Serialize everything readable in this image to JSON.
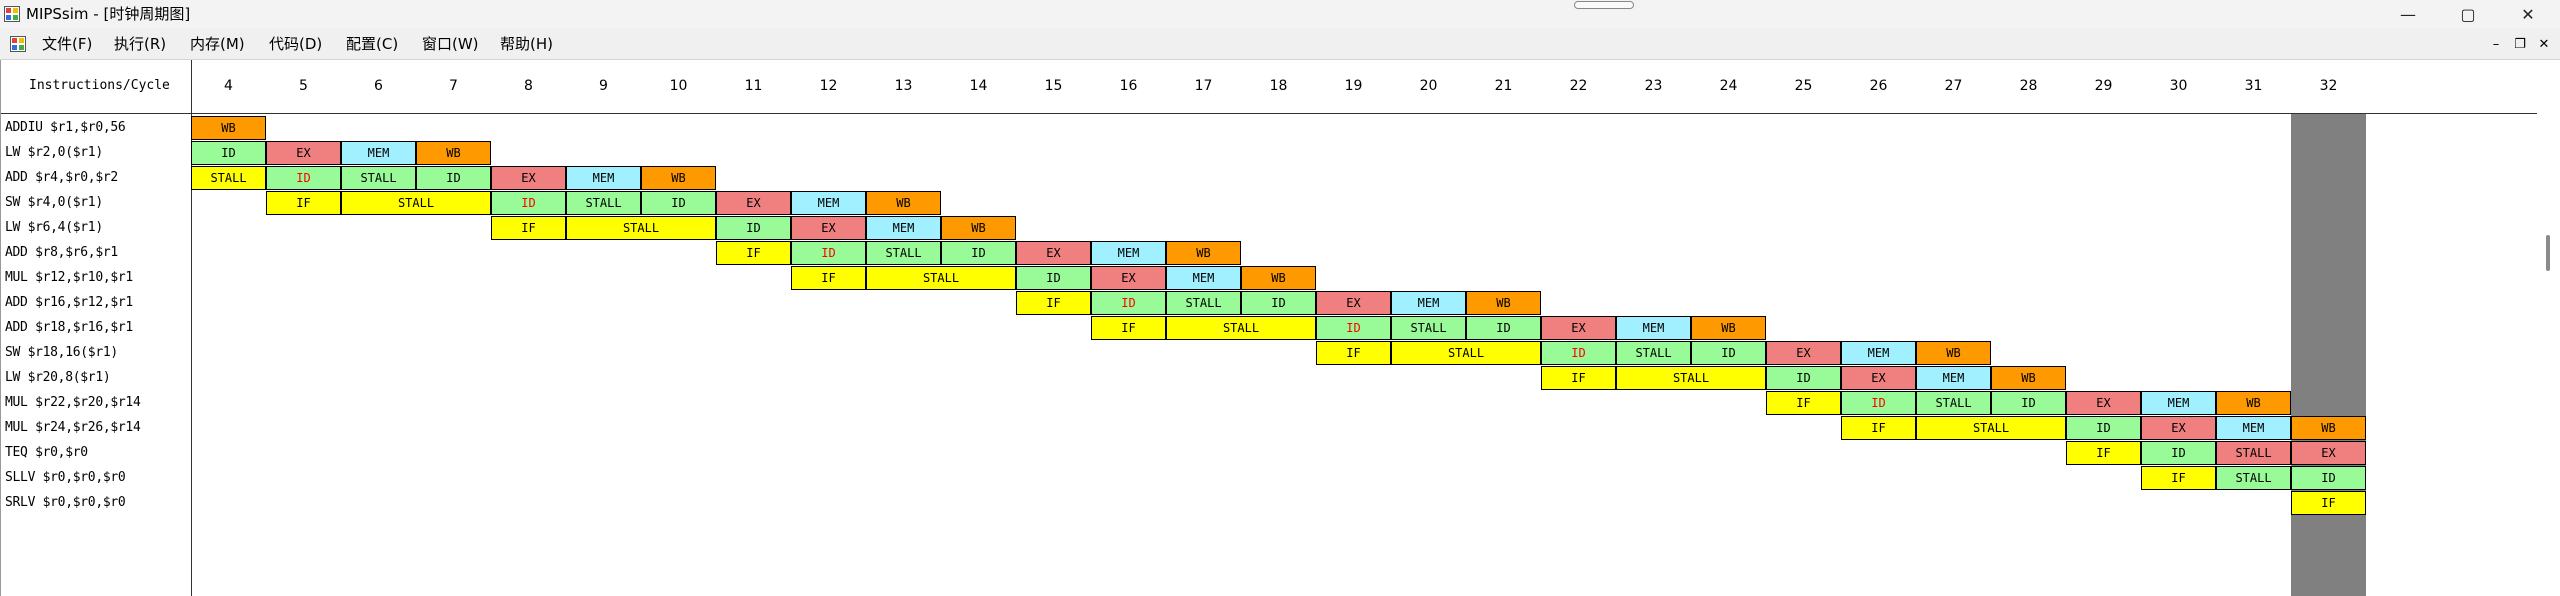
{
  "window": {
    "title": "MIPSsim - [时钟周期图]",
    "controls": {
      "minimize": "—",
      "maximize": "▢",
      "close": "✕"
    }
  },
  "menubar": {
    "items": [
      "文件(F)",
      "执行(R)",
      "内存(M)",
      "代码(D)",
      "配置(C)",
      "窗口(W)",
      "帮助(H)"
    ],
    "mdi_controls": {
      "minimize": "–",
      "restore": "❐",
      "close": "✕"
    }
  },
  "stage_colors": {
    "IF": "#ffff00",
    "ID": "#98fb98",
    "EX": "#f08080",
    "MEM": "#a0f0ff",
    "WB": "#ff9900",
    "STALL": "#ffff00"
  },
  "stalled_id_text_color": "#ff0000",
  "diagram": {
    "corner_header": "Instructions/Cycle",
    "cycles": [
      "4",
      "5",
      "6",
      "7",
      "8",
      "9",
      "10",
      "11",
      "12",
      "13",
      "14",
      "15",
      "16",
      "17",
      "18",
      "19",
      "20",
      "21",
      "22",
      "23",
      "24",
      "25",
      "26",
      "27",
      "28",
      "29",
      "30",
      "31",
      "32"
    ],
    "current_cycle": "32",
    "highlight_color": "#808080",
    "instructions": [
      {
        "label": "ADDIU $r1,$r0,56",
        "stages": [
          {
            "stage": "WB",
            "start": 4,
            "span": 1
          }
        ]
      },
      {
        "label": "LW $r2,0($r1)",
        "stages": [
          {
            "stage": "ID",
            "start": 4,
            "span": 1
          },
          {
            "stage": "EX",
            "start": 5,
            "span": 1,
            "text": "EX"
          },
          {
            "stage": "MEM",
            "start": 6,
            "span": 1
          },
          {
            "stage": "WB",
            "start": 7,
            "span": 1
          }
        ]
      },
      {
        "label": "ADD $r4,$r0,$r2",
        "stages": [
          {
            "stage": "STALL",
            "start": 4,
            "span": 1
          },
          {
            "stage": "ID",
            "start": 5,
            "span": 1,
            "stalled": true
          },
          {
            "stage": "ID",
            "start": 6,
            "span": 1,
            "text": "STALL"
          },
          {
            "stage": "ID",
            "start": 7,
            "span": 1
          },
          {
            "stage": "EX",
            "start": 8,
            "span": 1
          },
          {
            "stage": "MEM",
            "start": 9,
            "span": 1
          },
          {
            "stage": "WB",
            "start": 10,
            "span": 1
          }
        ]
      },
      {
        "label": "SW $r4,0($r1)",
        "stages": [
          {
            "stage": "IF",
            "start": 5,
            "span": 1
          },
          {
            "stage": "STALL",
            "start": 6,
            "span": 2
          },
          {
            "stage": "ID",
            "start": 8,
            "span": 1,
            "stalled": true
          },
          {
            "stage": "ID",
            "start": 9,
            "span": 1,
            "text": "STALL"
          },
          {
            "stage": "ID",
            "start": 10,
            "span": 1
          },
          {
            "stage": "EX",
            "start": 11,
            "span": 1
          },
          {
            "stage": "MEM",
            "start": 12,
            "span": 1
          },
          {
            "stage": "WB",
            "start": 13,
            "span": 1
          }
        ]
      },
      {
        "label": "LW $r6,4($r1)",
        "stages": [
          {
            "stage": "IF",
            "start": 8,
            "span": 1
          },
          {
            "stage": "STALL",
            "start": 9,
            "span": 2
          },
          {
            "stage": "ID",
            "start": 11,
            "span": 1
          },
          {
            "stage": "EX",
            "start": 12,
            "span": 1
          },
          {
            "stage": "MEM",
            "start": 13,
            "span": 1
          },
          {
            "stage": "WB",
            "start": 14,
            "span": 1
          }
        ]
      },
      {
        "label": "ADD $r8,$r6,$r1",
        "stages": [
          {
            "stage": "IF",
            "start": 11,
            "span": 1
          },
          {
            "stage": "ID",
            "start": 12,
            "span": 1,
            "stalled": true
          },
          {
            "stage": "ID",
            "start": 13,
            "span": 1,
            "text": "STALL"
          },
          {
            "stage": "ID",
            "start": 14,
            "span": 1
          },
          {
            "stage": "EX",
            "start": 15,
            "span": 1
          },
          {
            "stage": "MEM",
            "start": 16,
            "span": 1
          },
          {
            "stage": "WB",
            "start": 17,
            "span": 1
          }
        ]
      },
      {
        "label": "MUL $r12,$r10,$r1",
        "stages": [
          {
            "stage": "IF",
            "start": 12,
            "span": 1
          },
          {
            "stage": "STALL",
            "start": 13,
            "span": 2
          },
          {
            "stage": "ID",
            "start": 15,
            "span": 1
          },
          {
            "stage": "EX",
            "start": 16,
            "span": 1
          },
          {
            "stage": "MEM",
            "start": 17,
            "span": 1
          },
          {
            "stage": "WB",
            "start": 18,
            "span": 1
          }
        ]
      },
      {
        "label": "ADD $r16,$r12,$r1",
        "stages": [
          {
            "stage": "IF",
            "start": 15,
            "span": 1
          },
          {
            "stage": "ID",
            "start": 16,
            "span": 1,
            "stalled": true
          },
          {
            "stage": "ID",
            "start": 17,
            "span": 1,
            "text": "STALL"
          },
          {
            "stage": "ID",
            "start": 18,
            "span": 1
          },
          {
            "stage": "EX",
            "start": 19,
            "span": 1
          },
          {
            "stage": "MEM",
            "start": 20,
            "span": 1
          },
          {
            "stage": "WB",
            "start": 21,
            "span": 1
          }
        ]
      },
      {
        "label": "ADD $r18,$r16,$r1",
        "stages": [
          {
            "stage": "IF",
            "start": 16,
            "span": 1
          },
          {
            "stage": "STALL",
            "start": 17,
            "span": 2
          },
          {
            "stage": "ID",
            "start": 19,
            "span": 1,
            "stalled": true
          },
          {
            "stage": "ID",
            "start": 20,
            "span": 1,
            "text": "STALL"
          },
          {
            "stage": "ID",
            "start": 21,
            "span": 1
          },
          {
            "stage": "EX",
            "start": 22,
            "span": 1
          },
          {
            "stage": "MEM",
            "start": 23,
            "span": 1
          },
          {
            "stage": "WB",
            "start": 24,
            "span": 1
          }
        ]
      },
      {
        "label": "SW $r18,16($r1)",
        "stages": [
          {
            "stage": "IF",
            "start": 19,
            "span": 1
          },
          {
            "stage": "STALL",
            "start": 20,
            "span": 2
          },
          {
            "stage": "ID",
            "start": 22,
            "span": 1,
            "stalled": true
          },
          {
            "stage": "ID",
            "start": 23,
            "span": 1,
            "text": "STALL"
          },
          {
            "stage": "ID",
            "start": 24,
            "span": 1
          },
          {
            "stage": "EX",
            "start": 25,
            "span": 1
          },
          {
            "stage": "MEM",
            "start": 26,
            "span": 1
          },
          {
            "stage": "WB",
            "start": 27,
            "span": 1
          }
        ]
      },
      {
        "label": "LW $r20,8($r1)",
        "stages": [
          {
            "stage": "IF",
            "start": 22,
            "span": 1
          },
          {
            "stage": "STALL",
            "start": 23,
            "span": 2
          },
          {
            "stage": "ID",
            "start": 25,
            "span": 1
          },
          {
            "stage": "EX",
            "start": 26,
            "span": 1
          },
          {
            "stage": "MEM",
            "start": 27,
            "span": 1
          },
          {
            "stage": "WB",
            "start": 28,
            "span": 1
          }
        ]
      },
      {
        "label": "MUL $r22,$r20,$r14",
        "stages": [
          {
            "stage": "IF",
            "start": 25,
            "span": 1
          },
          {
            "stage": "ID",
            "start": 26,
            "span": 1,
            "stalled": true
          },
          {
            "stage": "ID",
            "start": 27,
            "span": 1,
            "text": "STALL"
          },
          {
            "stage": "ID",
            "start": 28,
            "span": 1
          },
          {
            "stage": "EX",
            "start": 29,
            "span": 1
          },
          {
            "stage": "MEM",
            "start": 30,
            "span": 1
          },
          {
            "stage": "WB",
            "start": 31,
            "span": 1
          }
        ]
      },
      {
        "label": "MUL $r24,$r26,$r14",
        "stages": [
          {
            "stage": "IF",
            "start": 26,
            "span": 1
          },
          {
            "stage": "STALL",
            "start": 27,
            "span": 2
          },
          {
            "stage": "ID",
            "start": 29,
            "span": 1
          },
          {
            "stage": "EX",
            "start": 30,
            "span": 1
          },
          {
            "stage": "MEM",
            "start": 31,
            "span": 1
          },
          {
            "stage": "WB",
            "start": 32,
            "span": 1
          }
        ]
      },
      {
        "label": "TEQ $r0,$r0",
        "stages": [
          {
            "stage": "IF",
            "start": 29,
            "span": 1
          },
          {
            "stage": "ID",
            "start": 30,
            "span": 1
          },
          {
            "stage": "EX",
            "start": 31,
            "span": 1,
            "text": "STALL"
          },
          {
            "stage": "EX",
            "start": 32,
            "span": 1
          }
        ]
      },
      {
        "label": "SLLV $r0,$r0,$r0",
        "stages": [
          {
            "stage": "IF",
            "start": 30,
            "span": 1
          },
          {
            "stage": "ID",
            "start": 31,
            "span": 1,
            "text": "STALL"
          },
          {
            "stage": "ID",
            "start": 32,
            "span": 1
          }
        ]
      },
      {
        "label": "SRLV $r0,$r0,$r0",
        "stages": [
          {
            "stage": "IF",
            "start": 32,
            "span": 1
          }
        ]
      }
    ]
  }
}
